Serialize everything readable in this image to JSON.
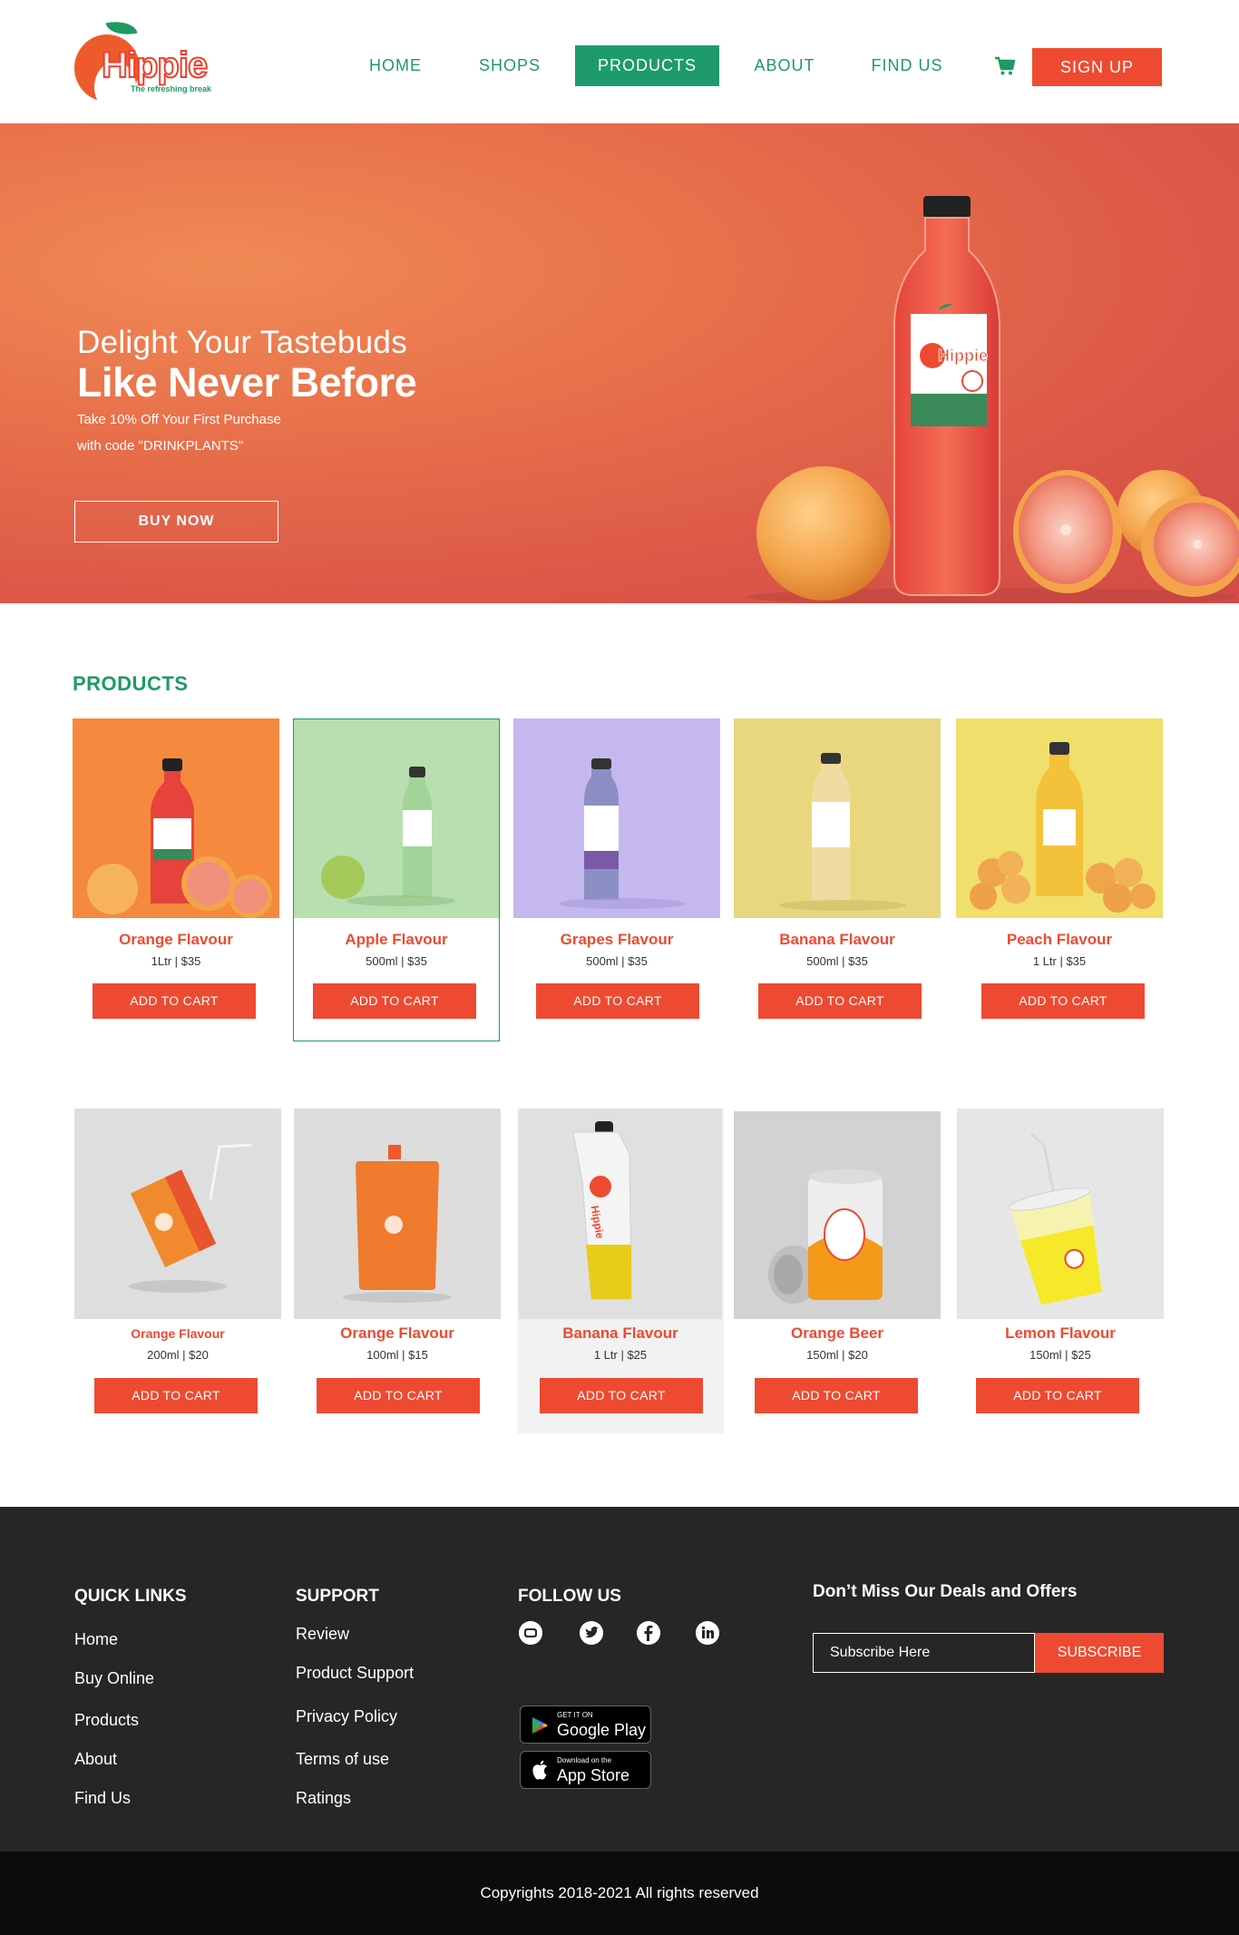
{
  "brand": {
    "name": "Hippie",
    "tagline": "The refreshing break"
  },
  "nav": {
    "items": [
      {
        "label": "HOME",
        "active": false
      },
      {
        "label": "SHOPS",
        "active": false
      },
      {
        "label": "PRODUCTS",
        "active": true
      },
      {
        "label": "ABOUT",
        "active": false
      },
      {
        "label": "FIND US",
        "active": false
      }
    ],
    "cart_icon": "shopping-cart-icon",
    "signup_label": "SIGN UP"
  },
  "hero": {
    "subtitle": "Delight Your  Tastebuds",
    "title": "Like Never Before",
    "line1": "Take 10% Off Your First Purchase",
    "line2": "with code \"DRINKPLANTS\"",
    "button": "BUY NOW"
  },
  "products": {
    "title": "PRODUCTS",
    "add_label": "ADD TO CART",
    "row1": [
      {
        "name": "Orange Flavour",
        "meta": "1Ltr  |  $35"
      },
      {
        "name": "Apple Flavour",
        "meta": "500ml | $35"
      },
      {
        "name": "Grapes Flavour",
        "meta": "500ml | $35"
      },
      {
        "name": "Banana Flavour",
        "meta": "500ml | $35"
      },
      {
        "name": "Peach Flavour",
        "meta": "1 Ltr | $35"
      }
    ],
    "row2": [
      {
        "name": "Orange Flavour",
        "meta": "200ml | $20"
      },
      {
        "name": "Orange Flavour",
        "meta": "100ml | $15"
      },
      {
        "name": "Banana Flavour",
        "meta": "1 Ltr | $25"
      },
      {
        "name": "Orange Beer",
        "meta": "150ml | $20"
      },
      {
        "name": "Lemon Flavour",
        "meta": "150ml | $25"
      }
    ]
  },
  "footer": {
    "quick_links": {
      "title": "QUICK LINKS",
      "items": [
        "Home",
        "Buy Online",
        "Products",
        "About",
        "Find Us"
      ]
    },
    "support": {
      "title": "SUPPORT",
      "items": [
        "Review",
        "Product Support",
        "Privacy Policy",
        "Terms of use",
        "Ratings"
      ]
    },
    "follow": {
      "title": "FOLLOW US",
      "icons": [
        "youtube-icon",
        "twitter-icon",
        "facebook-icon",
        "linkedin-icon"
      ]
    },
    "stores": {
      "google_small": "GET IT ON",
      "google_big": "Google Play",
      "apple_small": "Download on the",
      "apple_big": "App Store"
    },
    "deals": {
      "title": "Don’t Miss Our Deals and Offers",
      "placeholder": "Subscribe Here",
      "button": "SUBSCRIBE"
    },
    "copyright": "Copyrights 2018-2021 All rights reserved"
  },
  "colors": {
    "accent_green": "#1e9b62",
    "accent_red": "#ee4a32",
    "footer_bg": "#262626"
  }
}
